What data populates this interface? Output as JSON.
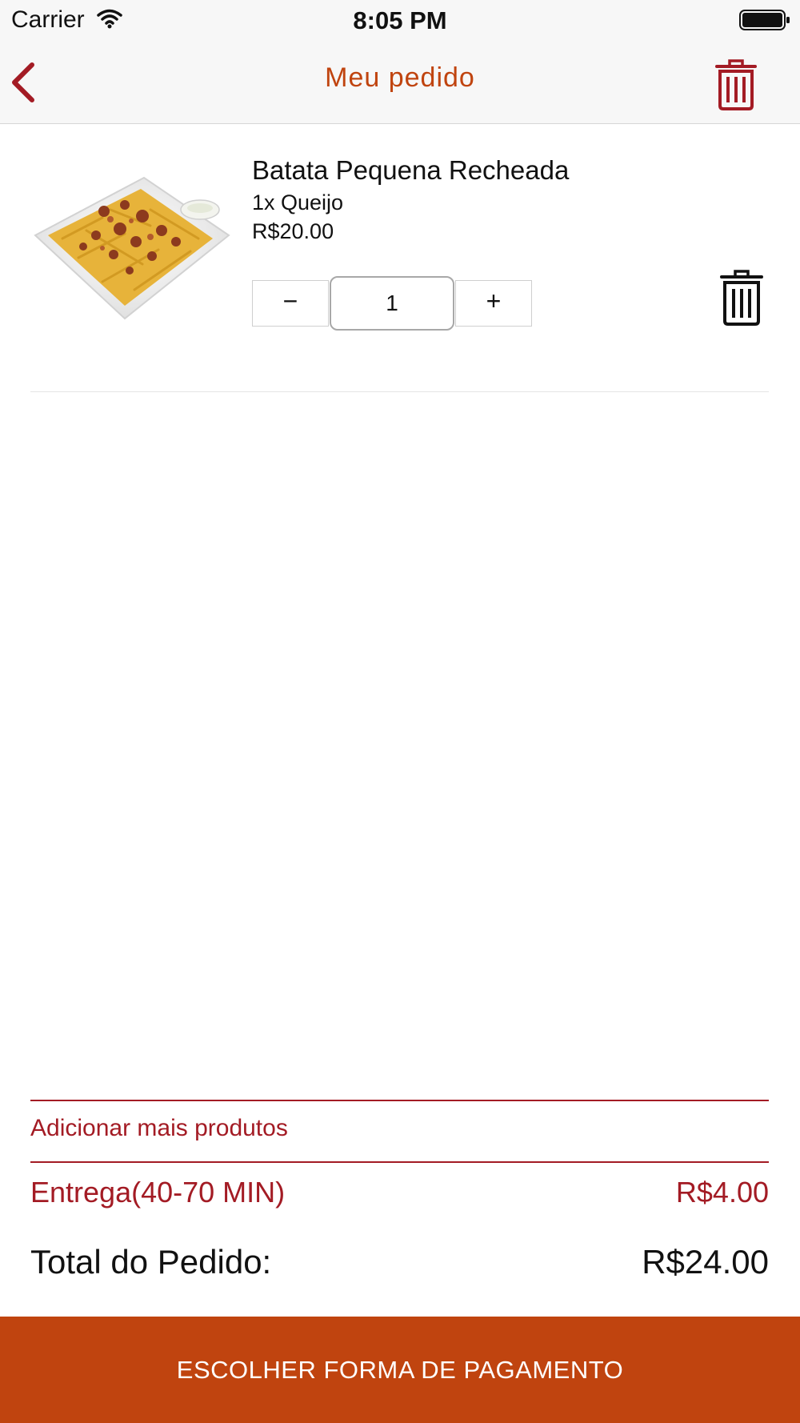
{
  "status_bar": {
    "carrier": "Carrier",
    "time": "8:05 PM"
  },
  "header": {
    "title": "Meu pedido",
    "back_icon": "chevron-left-icon",
    "clear_icon": "trash-icon"
  },
  "cart_items": [
    {
      "image": "loaded-fries-with-bacon-photo",
      "name": "Batata Pequena Recheada",
      "option": "1x Queijo",
      "price": "R$20.00",
      "decrement_label": "−",
      "quantity": "1",
      "increment_label": "+",
      "remove_icon": "trash-icon"
    }
  ],
  "footer": {
    "add_more": "Adicionar mais produtos",
    "delivery_label": "Entrega(40-70 MIN)",
    "delivery_value": "R$4.00",
    "total_label": "Total do Pedido:",
    "total_value": "R$24.00",
    "pay_button": "ESCOLHER FORMA DE PAGAMENTO"
  },
  "colors": {
    "accent_orange": "#c0440f",
    "accent_red": "#a31b24",
    "bar_background": "#f7f7f7"
  }
}
